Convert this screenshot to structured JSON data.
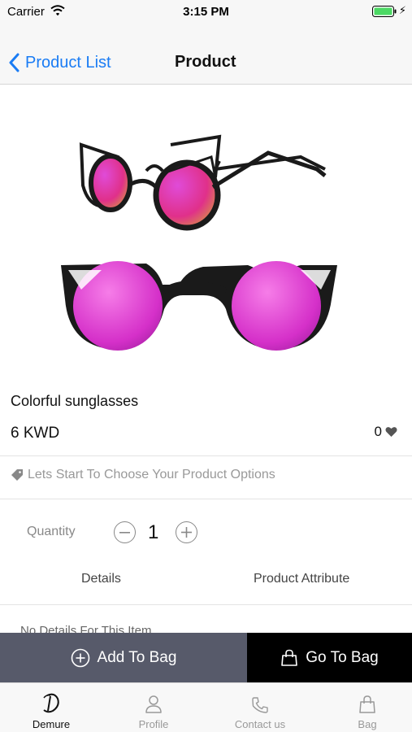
{
  "status_bar": {
    "carrier": "Carrier",
    "time": "3:15 PM",
    "battery_color": "#4cd964"
  },
  "nav": {
    "back_label": "Product List",
    "title": "Product",
    "accent_color": "#1a7cf4"
  },
  "product": {
    "image_icon": "sunglasses-image",
    "name": "Colorful sunglasses",
    "price": "6 KWD",
    "likes": "0"
  },
  "options": {
    "label": "Lets Start To Choose Your Product Options"
  },
  "quantity": {
    "label": "Quantity",
    "value": "1"
  },
  "tabs": {
    "details": "Details",
    "attribute": "Product Attribute"
  },
  "details_text": "No Details For This Item",
  "actions": {
    "add_to_bag": "Add To Bag",
    "go_to_bag": "Go To Bag"
  },
  "tab_bar": [
    {
      "label": "Demure",
      "icon": "demure-logo-icon"
    },
    {
      "label": "Profile",
      "icon": "person-icon"
    },
    {
      "label": "Contact us",
      "icon": "phone-icon"
    },
    {
      "label": "Bag",
      "icon": "bag-icon"
    }
  ]
}
